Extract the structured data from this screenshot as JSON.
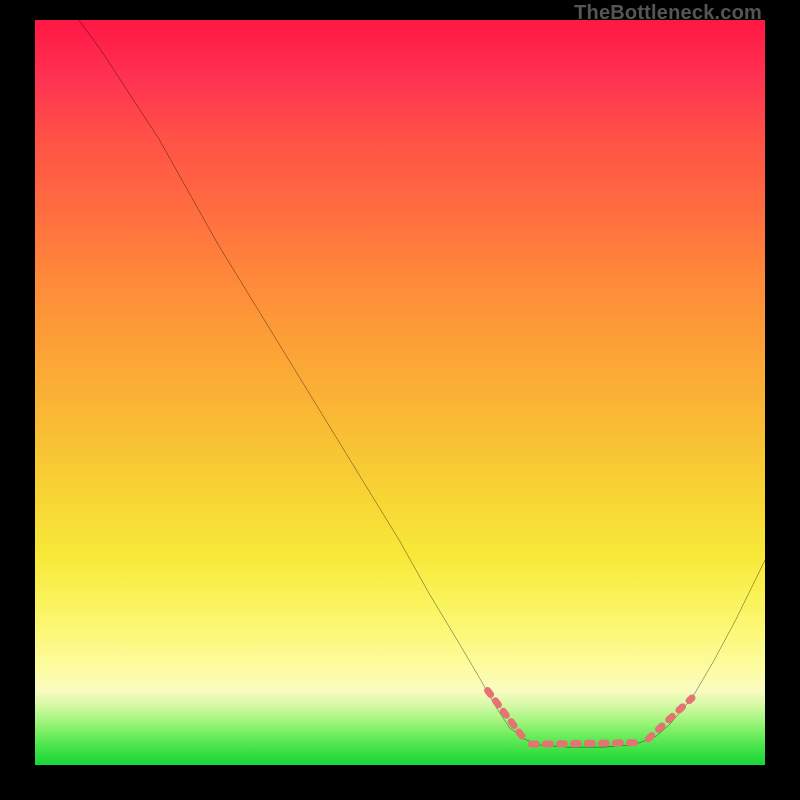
{
  "watermark": "TheBottleneck.com",
  "chart_data": {
    "type": "line",
    "title": "",
    "xlabel": "",
    "ylabel": "",
    "xlim": [
      0,
      100
    ],
    "ylim": [
      0,
      100
    ],
    "background": "vertical-gradient red(top) → orange → yellow → green(bottom)",
    "comment": "Pixel-space polyline. x_pct,y_pct are percent of plot width/height (origin top-left). Values estimated from gridless image.",
    "series": [
      {
        "name": "curve-main",
        "color": "#000000",
        "stroke_width_px": 2,
        "points_pct": [
          [
            6.0,
            0.0
          ],
          [
            9.0,
            4.0
          ],
          [
            13.0,
            10.0
          ],
          [
            17.0,
            16.0
          ],
          [
            21.0,
            23.0
          ],
          [
            25.0,
            30.0
          ],
          [
            30.0,
            38.0
          ],
          [
            35.0,
            46.0
          ],
          [
            40.0,
            54.0
          ],
          [
            45.0,
            62.0
          ],
          [
            50.0,
            70.0
          ],
          [
            54.0,
            77.0
          ],
          [
            58.0,
            83.5
          ],
          [
            61.0,
            88.5
          ],
          [
            63.0,
            92.0
          ],
          [
            65.0,
            95.0
          ],
          [
            67.0,
            96.5
          ],
          [
            69.0,
            97.3
          ],
          [
            73.0,
            97.6
          ],
          [
            78.0,
            97.6
          ],
          [
            82.0,
            97.3
          ],
          [
            85.0,
            96.2
          ],
          [
            87.0,
            94.5
          ],
          [
            90.0,
            91.0
          ],
          [
            93.0,
            86.0
          ],
          [
            96.0,
            80.5
          ],
          [
            100.0,
            72.5
          ]
        ]
      },
      {
        "name": "dash-segment-left",
        "color": "#e57373",
        "stroke_width_px": 6,
        "dash": true,
        "points_pct": [
          [
            62.0,
            90.0
          ],
          [
            67.0,
            96.5
          ]
        ]
      },
      {
        "name": "dash-segment-bottom",
        "color": "#e57373",
        "stroke_width_px": 6,
        "dash": true,
        "points_pct": [
          [
            68.0,
            97.2
          ],
          [
            83.0,
            97.0
          ]
        ]
      },
      {
        "name": "dash-segment-right",
        "color": "#e57373",
        "stroke_width_px": 6,
        "dash": true,
        "points_pct": [
          [
            84.0,
            96.5
          ],
          [
            90.0,
            91.0
          ]
        ]
      }
    ]
  }
}
